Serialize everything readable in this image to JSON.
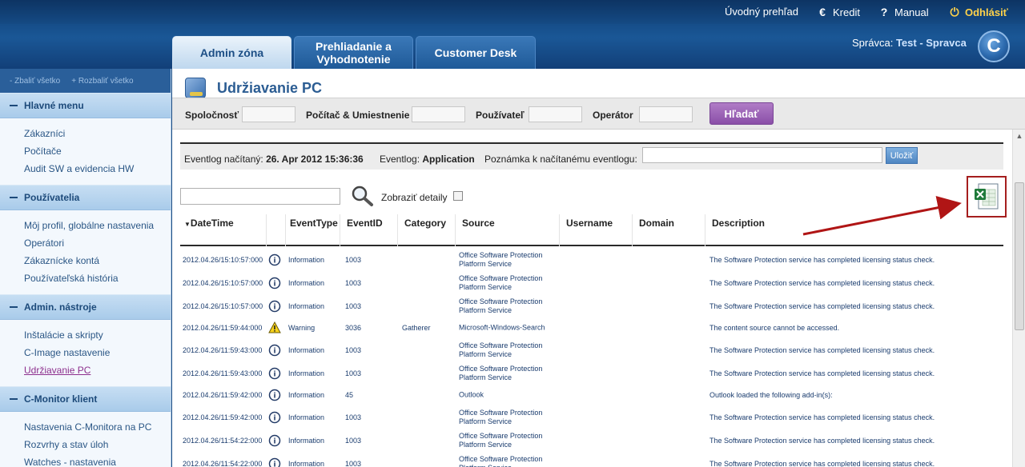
{
  "topnav": {
    "home": "Úvodný prehľad",
    "credit": "Kredit",
    "manual": "Manual",
    "logout": "Odhlásiť"
  },
  "tabs": [
    {
      "label": "Admin zóna"
    },
    {
      "label": "Prehliadanie a Vyhodnotenie"
    },
    {
      "label": "Customer Desk"
    }
  ],
  "admin": {
    "prefix": "Správca:",
    "name": "Test - Spravca"
  },
  "logo_letter": "C",
  "sidebar": {
    "collapse_all": "- Zbaliť všetko",
    "expand_all": "+ Rozbaliť všetko",
    "sections": [
      {
        "title": "Hlavné menu",
        "items": [
          "Zákazníci",
          "Počítače",
          "Audit SW a evidencia HW"
        ]
      },
      {
        "title": "Používatelia",
        "items": [
          "Môj profil, globálne nastavenia",
          "Operátori",
          "Zákaznícke kontá",
          "Používateľská história"
        ]
      },
      {
        "title": "Admin. nástroje",
        "items": [
          "Inštalácie a skripty",
          "C-Image nastavenie",
          "Udržiavanie PC"
        ]
      },
      {
        "title": "C-Monitor klient",
        "items": [
          "Nastavenia C-Monitora na PC",
          "Rozvrhy a stav úloh",
          "Watches - nastavenia"
        ]
      }
    ]
  },
  "page": {
    "title": "Udržiavanie PC"
  },
  "filters": {
    "company": "Spoločnosť",
    "computer": "Počítač & Umiestnenie",
    "user": "Používateľ",
    "operator": "Operátor",
    "search_button": "Hľadať"
  },
  "eventlog": {
    "loaded_label": "Eventlog načítaný:",
    "loaded_value": "26. Apr 2012 15:36:36",
    "log_label": "Eventlog:",
    "log_value": "Application",
    "note_label": "Poznámka k načítanému eventlogu:",
    "save_button": "Uložiť"
  },
  "table_tools": {
    "details_label": "Zobraziť detaily"
  },
  "columns": [
    "DateTime",
    "EventType",
    "EventID",
    "Category",
    "Source",
    "Username",
    "Domain",
    "Description"
  ],
  "rows": [
    {
      "datetime": "2012.04.26/15:10:57:000",
      "icon": "info-icon",
      "type": "Information",
      "id": "1003",
      "category": "",
      "source": "Office Software Protection Platform Service",
      "description": "The Software Protection service has completed licensing status check."
    },
    {
      "datetime": "2012.04.26/15:10:57:000",
      "icon": "info-icon",
      "type": "Information",
      "id": "1003",
      "category": "",
      "source": "Office Software Protection Platform Service",
      "description": "The Software Protection service has completed licensing status check."
    },
    {
      "datetime": "2012.04.26/15:10:57:000",
      "icon": "info-icon",
      "type": "Information",
      "id": "1003",
      "category": "",
      "source": "Office Software Protection Platform Service",
      "description": "The Software Protection service has completed licensing status check."
    },
    {
      "datetime": "2012.04.26/11:59:44:000",
      "icon": "warning-icon",
      "type": "Warning",
      "id": "3036",
      "category": "Gatherer",
      "source": "Microsoft-Windows-Search",
      "description": "The content source cannot be accessed."
    },
    {
      "datetime": "2012.04.26/11:59:43:000",
      "icon": "info-icon",
      "type": "Information",
      "id": "1003",
      "category": "",
      "source": "Office Software Protection Platform Service",
      "description": "The Software Protection service has completed licensing status check."
    },
    {
      "datetime": "2012.04.26/11:59:43:000",
      "icon": "info-icon",
      "type": "Information",
      "id": "1003",
      "category": "",
      "source": "Office Software Protection Platform Service",
      "description": "The Software Protection service has completed licensing status check."
    },
    {
      "datetime": "2012.04.26/11:59:42:000",
      "icon": "info-icon",
      "type": "Information",
      "id": "45",
      "category": "",
      "source": "Outlook",
      "description": "Outlook loaded the following add-in(s):"
    },
    {
      "datetime": "2012.04.26/11:59:42:000",
      "icon": "info-icon",
      "type": "Information",
      "id": "1003",
      "category": "",
      "source": "Office Software Protection Platform Service",
      "description": "The Software Protection service has completed licensing status check."
    },
    {
      "datetime": "2012.04.26/11:54:22:000",
      "icon": "info-icon",
      "type": "Information",
      "id": "1003",
      "category": "",
      "source": "Office Software Protection Platform Service",
      "description": "The Software Protection service has completed licensing status check."
    },
    {
      "datetime": "2012.04.26/11:54:22:000",
      "icon": "info-icon",
      "type": "Information",
      "id": "1003",
      "category": "",
      "source": "Office Software Protection Platform Service",
      "description": "The Software Protection service has completed licensing status check."
    }
  ]
}
